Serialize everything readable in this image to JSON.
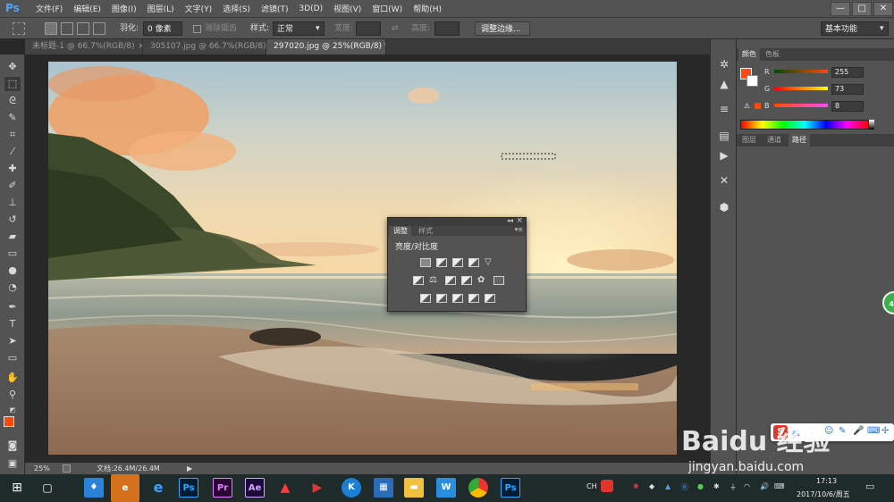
{
  "app": {
    "logo": "Ps"
  },
  "menu": [
    "文件(F)",
    "编辑(E)",
    "图像(I)",
    "图层(L)",
    "文字(Y)",
    "选择(S)",
    "滤镜(T)",
    "3D(D)",
    "视图(V)",
    "窗口(W)",
    "帮助(H)"
  ],
  "window_controls": {
    "minimize": "—",
    "maximize": "□",
    "close": "✕"
  },
  "options": {
    "feather_label": "羽化:",
    "feather_value": "0 像素",
    "antialias_label": "消除锯齿",
    "style_label": "样式:",
    "style_value": "正常",
    "width_label": "宽度:",
    "height_label": "高度:",
    "refine_edge": "调整边缘...",
    "workspace": "基本功能"
  },
  "tabs": [
    {
      "title": "未标题-1 @ 66.7%(RGB/8)",
      "close": "×"
    },
    {
      "title": "305107.jpg @ 66.7%(RGB/8)",
      "close": "×"
    },
    {
      "title": "297020.jpg @ 25%(RGB/8) *",
      "close": "×"
    }
  ],
  "status": {
    "zoom": "25%",
    "doc": "文档:26.4M/26.4M"
  },
  "adjustments_panel": {
    "tabs": [
      "调整",
      "样式"
    ],
    "heading": "亮度/对比度",
    "collapse": "◂◂",
    "close": "×",
    "menu": "▾≡"
  },
  "color_panel": {
    "tabs": [
      "颜色",
      "色板"
    ],
    "r_label": "R",
    "r_value": "255",
    "g_label": "G",
    "g_value": "73",
    "b_label": "B",
    "b_value": "8",
    "foreground": "#ff4908"
  },
  "layers_panel": {
    "tabs": [
      "图层",
      "通道",
      "路径"
    ]
  },
  "taskbar": {
    "time": "17:13",
    "date": "2017/10/6/周五",
    "ime": "CH"
  },
  "watermark": {
    "brand": "Baidu 经验",
    "url": "jingyan.baidu.com"
  },
  "badge": {
    "value": "48"
  },
  "ime_toolbar": {
    "mode": "英"
  }
}
